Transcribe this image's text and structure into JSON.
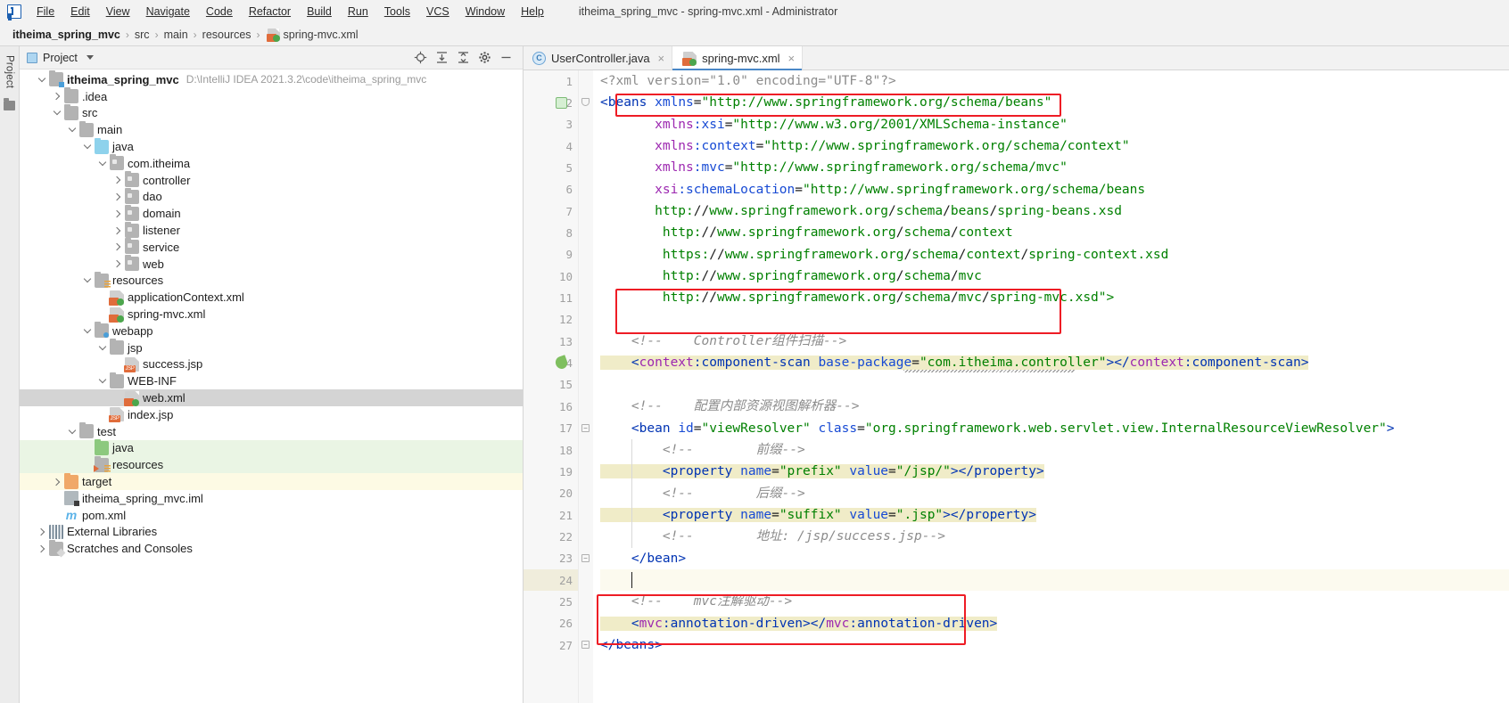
{
  "window": {
    "title": "itheima_spring_mvc - spring-mvc.xml - Administrator",
    "app_icon": "intellij-idea-logo"
  },
  "menu": [
    {
      "label": "File"
    },
    {
      "label": "Edit"
    },
    {
      "label": "View"
    },
    {
      "label": "Navigate"
    },
    {
      "label": "Code"
    },
    {
      "label": "Refactor"
    },
    {
      "label": "Build"
    },
    {
      "label": "Run"
    },
    {
      "label": "Tools"
    },
    {
      "label": "VCS"
    },
    {
      "label": "Window"
    },
    {
      "label": "Help"
    }
  ],
  "breadcrumb": {
    "items": [
      "itheima_spring_mvc",
      "src",
      "main",
      "resources",
      "spring-mvc.xml"
    ],
    "separator": "›"
  },
  "rail": {
    "label": "Project"
  },
  "project_panel": {
    "title": "Project",
    "tools": [
      "locate-icon",
      "expand-all-icon",
      "collapse-all-icon",
      "gear-icon",
      "hide-icon"
    ]
  },
  "tree": [
    {
      "depth": 0,
      "arrow": "down",
      "icon": "module-folder",
      "label": "itheima_spring_mvc",
      "bold": true,
      "path": "D:\\IntelliJ IDEA 2021.3.2\\code\\itheima_spring_mvc",
      "bg": "none"
    },
    {
      "depth": 1,
      "arrow": "right",
      "icon": "folder",
      "label": ".idea",
      "bold": false,
      "path": "",
      "bg": "none"
    },
    {
      "depth": 1,
      "arrow": "down",
      "icon": "folder",
      "label": "src",
      "bold": false,
      "path": "",
      "bg": "none"
    },
    {
      "depth": 2,
      "arrow": "down",
      "icon": "folder",
      "label": "main",
      "bold": false,
      "path": "",
      "bg": "none"
    },
    {
      "depth": 3,
      "arrow": "down",
      "icon": "folder-source",
      "label": "java",
      "bold": false,
      "path": "",
      "bg": "none"
    },
    {
      "depth": 4,
      "arrow": "down",
      "icon": "package",
      "label": "com.itheima",
      "bold": false,
      "path": "",
      "bg": "none"
    },
    {
      "depth": 5,
      "arrow": "right",
      "icon": "package",
      "label": "controller",
      "bold": false,
      "path": "",
      "bg": "none"
    },
    {
      "depth": 5,
      "arrow": "right",
      "icon": "package",
      "label": "dao",
      "bold": false,
      "path": "",
      "bg": "none"
    },
    {
      "depth": 5,
      "arrow": "right",
      "icon": "package",
      "label": "domain",
      "bold": false,
      "path": "",
      "bg": "none"
    },
    {
      "depth": 5,
      "arrow": "right",
      "icon": "package",
      "label": "listener",
      "bold": false,
      "path": "",
      "bg": "none"
    },
    {
      "depth": 5,
      "arrow": "right",
      "icon": "package",
      "label": "service",
      "bold": false,
      "path": "",
      "bg": "none"
    },
    {
      "depth": 5,
      "arrow": "right",
      "icon": "package",
      "label": "web",
      "bold": false,
      "path": "",
      "bg": "none"
    },
    {
      "depth": 3,
      "arrow": "down",
      "icon": "folder-resource",
      "label": "resources",
      "bold": false,
      "path": "",
      "bg": "none"
    },
    {
      "depth": 4,
      "arrow": "none",
      "icon": "xml-spring-file",
      "label": "applicationContext.xml",
      "bold": false,
      "path": "",
      "bg": "none"
    },
    {
      "depth": 4,
      "arrow": "none",
      "icon": "xml-spring-file",
      "label": "spring-mvc.xml",
      "bold": false,
      "path": "",
      "bg": "none"
    },
    {
      "depth": 3,
      "arrow": "down",
      "icon": "folder-webapp",
      "label": "webapp",
      "bold": false,
      "path": "",
      "bg": "none"
    },
    {
      "depth": 4,
      "arrow": "down",
      "icon": "folder",
      "label": "jsp",
      "bold": false,
      "path": "",
      "bg": "none"
    },
    {
      "depth": 5,
      "arrow": "none",
      "icon": "jsp-file",
      "label": "success.jsp",
      "bold": false,
      "path": "",
      "bg": "none"
    },
    {
      "depth": 4,
      "arrow": "down",
      "icon": "folder",
      "label": "WEB-INF",
      "bold": false,
      "path": "",
      "bg": "none"
    },
    {
      "depth": 5,
      "arrow": "none",
      "icon": "xml-spring-file",
      "label": "web.xml",
      "bold": false,
      "path": "",
      "bg": "selected"
    },
    {
      "depth": 4,
      "arrow": "none",
      "icon": "jsp-file",
      "label": "index.jsp",
      "bold": false,
      "path": "",
      "bg": "none"
    },
    {
      "depth": 2,
      "arrow": "down",
      "icon": "folder",
      "label": "test",
      "bold": false,
      "path": "",
      "bg": "none"
    },
    {
      "depth": 3,
      "arrow": "none",
      "icon": "folder-test-src",
      "label": "java",
      "bold": false,
      "path": "",
      "bg": "green"
    },
    {
      "depth": 3,
      "arrow": "none",
      "icon": "folder-test-res",
      "label": "resources",
      "bold": false,
      "path": "",
      "bg": "green"
    },
    {
      "depth": 1,
      "arrow": "right",
      "icon": "folder-excluded",
      "label": "target",
      "bold": false,
      "path": "",
      "bg": "yellow"
    },
    {
      "depth": 1,
      "arrow": "none",
      "icon": "iml-file",
      "label": "itheima_spring_mvc.iml",
      "bold": false,
      "path": "",
      "bg": "none"
    },
    {
      "depth": 1,
      "arrow": "none",
      "icon": "maven-file",
      "label": "pom.xml",
      "bold": false,
      "path": "",
      "bg": "none"
    },
    {
      "depth": 0,
      "arrow": "right",
      "icon": "library-icon",
      "label": "External Libraries",
      "bold": false,
      "path": "",
      "bg": "none"
    },
    {
      "depth": 0,
      "arrow": "right",
      "icon": "scratches-icon",
      "label": "Scratches and Consoles",
      "bold": false,
      "path": "",
      "bg": "none"
    }
  ],
  "editor_tabs": [
    {
      "label": "UserController.java",
      "icon": "java-class-icon",
      "active": false,
      "close": "×"
    },
    {
      "label": "spring-mvc.xml",
      "icon": "xml-spring-file",
      "active": true,
      "close": "×"
    }
  ],
  "editor": {
    "file": "spring-mvc.xml",
    "caret_line": 24,
    "first_visible_line": 1,
    "lines": [
      {
        "n": 1,
        "text": "<?xml version=\"1.0\" encoding=\"UTF-8\"?>"
      },
      {
        "n": 2,
        "text": "<beans xmlns=\"http://www.springframework.org/schema/beans\""
      },
      {
        "n": 3,
        "text": "       xmlns:xsi=\"http://www.w3.org/2001/XMLSchema-instance\""
      },
      {
        "n": 4,
        "text": "       xmlns:context=\"http://www.springframework.org/schema/context\""
      },
      {
        "n": 5,
        "text": "       xmlns:mvc=\"http://www.springframework.org/schema/mvc\""
      },
      {
        "n": 6,
        "text": "       xsi:schemaLocation=\"http://www.springframework.org/schema/beans"
      },
      {
        "n": 7,
        "text": "       http://www.springframework.org/schema/beans/spring-beans.xsd"
      },
      {
        "n": 8,
        "text": "        http://www.springframework.org/schema/context"
      },
      {
        "n": 9,
        "text": "        https://www.springframework.org/schema/context/spring-context.xsd"
      },
      {
        "n": 10,
        "text": "        http://www.springframework.org/schema/mvc"
      },
      {
        "n": 11,
        "text": "        http://www.springframework.org/schema/mvc/spring-mvc.xsd\">"
      },
      {
        "n": 12,
        "text": ""
      },
      {
        "n": 13,
        "text": "    <!--    Controller组件扫描-->"
      },
      {
        "n": 14,
        "text": "    <context:component-scan base-package=\"com.itheima.controller\"></context:component-scan>"
      },
      {
        "n": 15,
        "text": ""
      },
      {
        "n": 16,
        "text": "    <!--    配置内部资源视图解析器-->"
      },
      {
        "n": 17,
        "text": "    <bean id=\"viewResolver\" class=\"org.springframework.web.servlet.view.InternalResourceViewResolver\">"
      },
      {
        "n": 18,
        "text": "        <!--        前缀-->"
      },
      {
        "n": 19,
        "text": "        <property name=\"prefix\" value=\"/jsp/\"></property>"
      },
      {
        "n": 20,
        "text": "        <!--        后缀-->"
      },
      {
        "n": 21,
        "text": "        <property name=\"suffix\" value=\".jsp\"></property>"
      },
      {
        "n": 22,
        "text": "        <!--        地址: /jsp/success.jsp-->"
      },
      {
        "n": 23,
        "text": "    </bean>"
      },
      {
        "n": 24,
        "text": ""
      },
      {
        "n": 25,
        "text": "    <!--    mvc注解驱动-->"
      },
      {
        "n": 26,
        "text": "    <mvc:annotation-driven></mvc:annotation-driven>"
      },
      {
        "n": 27,
        "text": "</beans>"
      }
    ],
    "highlighted_lines": [
      14,
      19,
      21,
      26
    ],
    "annotations": [
      {
        "name": "xmlns-mvc-highlight",
        "lines": [
          5
        ]
      },
      {
        "name": "schema-location-mvc-highlight",
        "lines": [
          10,
          11
        ]
      },
      {
        "name": "annotation-driven-highlight",
        "lines": [
          25,
          26
        ]
      }
    ]
  },
  "colors": {
    "accent_blue": "#4a88c7",
    "annotation_red": "#ee1c25",
    "tag_blue": "#0033b3",
    "attr_blue": "#174ad4",
    "value_green": "#008000",
    "namespace_purple": "#9c27b0",
    "comment_gray": "#8c8c8c",
    "highlight_tan": "#f0ecc8",
    "selection_gray": "#d4d4d4"
  }
}
